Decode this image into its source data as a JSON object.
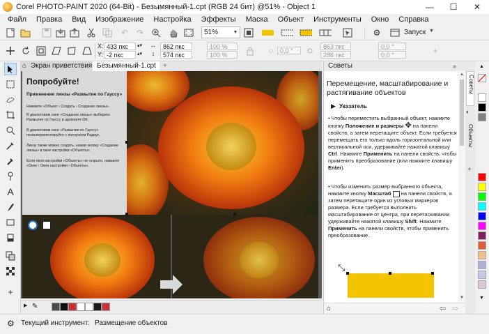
{
  "window": {
    "title": "Corel PHOTO-PAINT 2020 (64-Bit) - Безымянный-1.cpt (RGB 24 бит) @51% - Object 1",
    "minimize": "—",
    "maximize": "☐",
    "close": "✕"
  },
  "menu": [
    "Файл",
    "Правка",
    "Вид",
    "Изображение",
    "Настройка",
    "Эффекты",
    "Маска",
    "Объект",
    "Инструменты",
    "Окно",
    "Справка"
  ],
  "toolbar": {
    "zoom": "51%",
    "launch": "Запуск"
  },
  "propbar": {
    "x_label": "X:",
    "x_value": "433 пкс",
    "y_label": "Y:",
    "y_value": "-2 пкс",
    "w_value": "862 пкс",
    "h_value": "574 пкс",
    "sx_value": "100 %",
    "sy_value": "100 %",
    "rot_value": "0,0 °",
    "cx_value": "863 пкс",
    "cy_value": "286 пкс",
    "skx_value": "0,0 °",
    "sky_value": "0,0 °"
  },
  "tabs": {
    "welcome": "Экран приветствия",
    "doc": "Безымянный-1.cpt",
    "add": "+"
  },
  "canvas_panel": {
    "heading": "Попробуйте!",
    "subheading": "Применение линзы «Размытие по Гауссу»",
    "p1": "Нажмите «Объект › Создать › Создание линзы».",
    "p2": "В диалоговом окне «Создание линзы» выберите Размытие по Гауссу и щелкните ОК.",
    "p3": "В диалоговом окне «Размытие по Гауссу» поэкспериментируйте с ползунком Радиус.",
    "p4": "Линзу также можно создать, нажав кнопку «Создание линзы» в окне настройки «Объекты».",
    "p5": "Если окно настройки «Объекты» не открыто, нажмите «Окно › Окна настройки › Объекты»."
  },
  "docker": {
    "header": "Советы",
    "title": "Перемещение, масштабирование и растягивание объектов",
    "tool_name": "Указатель",
    "b1": "Чтобы переместить выбранный объект, нажмите кнопку",
    "b1_bold": "Положение и размеры",
    "b1_rest": "на панели свойств, а затем перетащите объект. Если требуется перемещать его только вдоль горизонтальной или вертикальной оси, удерживайте нажатой клавишу",
    "b1_key": "Ctrl",
    "b1_press": ". Нажмите",
    "b1_apply": "Применить",
    "b1_end": "на панели свойств, чтобы применить преобразование (или нажмите клавишу",
    "b1_enter": "Enter",
    "b1_close": ").",
    "b2": "Чтобы изменить размер выбранного объекта, нажмите кнопку",
    "b2_bold": "Масштаб",
    "b2_rest": "на панели свойств, а затем перетащите один из угловых маркеров размера. Если требуется выполнить масштабирование от центра, при перетаскивании удерживайте нажатой клавишу",
    "b2_key": "Shift",
    "b2_press": ". Нажмите",
    "b2_apply": "Применить",
    "b2_end": "на панели свойств, чтобы применить преобразование."
  },
  "docker_tabs": [
    "Советы",
    "Объекты"
  ],
  "palette": [
    "#ffffff",
    "#000000",
    "#808080",
    "#ff0000",
    "#ffff00",
    "#00ff00",
    "#00ffff",
    "#0000ff",
    "#ff00ff",
    "#7f1f5f",
    "#e0603a",
    "#f4c08a",
    "#b0b0d8",
    "#c8c8e8",
    "#d8c8d8"
  ],
  "bottom_colors": [
    "#4a4a4a",
    "#111111",
    "#c83232",
    "#ffffff",
    "#ffffff",
    "#1a1a1a",
    "#c83232"
  ],
  "status": {
    "label": "Текущий инструмент:",
    "value": "Размещение объектов"
  },
  "colors": {
    "accent": "#1f6fbf",
    "yellow_rect": "#f5c400"
  }
}
